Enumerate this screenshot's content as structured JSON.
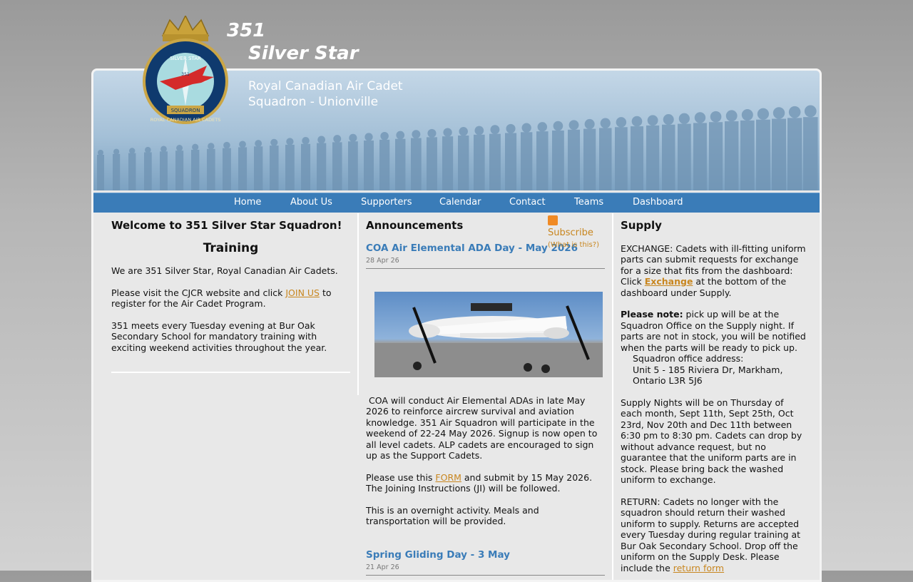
{
  "site": {
    "number": "351",
    "name": "Silver Star",
    "subtitle_line1": "Royal Canadian Air Cadet",
    "subtitle_line2": "Squadron - Unionville"
  },
  "crest": {
    "top_text": "SILVER STAR",
    "number": "351",
    "band_text": "SQUADRON",
    "ring_text": "ROYAL CANADIAN AIR CADETS"
  },
  "nav": [
    "Home",
    "About Us",
    "Supporters",
    "Calendar",
    "Contact",
    "Teams",
    "Dashboard"
  ],
  "left": {
    "heading": "Welcome to 351 Silver Star Squadron!",
    "subheading": "Training",
    "p1": "We are 351 Silver Star, Royal Canadian Air Cadets.",
    "p2_before": "Please visit the CJCR website and click ",
    "p2_link": "JOIN US",
    "p2_after": " to register for the Air Cadet Program.",
    "p3": "351 meets every Tuesday evening at Bur Oak Secondary School for mandatory training with exciting weekend activities throughout the year."
  },
  "middle": {
    "heading": "Announcements",
    "subscribe": "Subscribe",
    "whatis": "(What is this?)",
    "post1": {
      "title": "COA Air Elemental ADA Day - May 2026",
      "date": "28 Apr 26",
      "p1": "COA will conduct Air Elemental ADAs in late May 2026 to reinforce aircrew survival and aviation knowledge. 351 Air Squadron will participate in the weekend of 22-24 May 2026. Signup is now open to all level cadets. ALP cadets are encouraged to sign up as the Support Cadets.",
      "p2_before": "Please use this ",
      "p2_link": "FORM",
      "p2_after": " and submit by 15 May 2026. The Joining Instructions (JI) will be followed.",
      "p3": "This is an overnight activity. Meals and transportation will be provided."
    },
    "post2": {
      "title": "Spring Gliding Day - 3 May",
      "date": "21 Apr 26"
    }
  },
  "right": {
    "heading": "Supply",
    "p1_before": "EXCHANGE: Cadets with ill-fitting uniform parts can submit requests for exchange for a size that fits from the dashboard: Click ",
    "p1_link": "Exchange",
    "p1_after": " at the bottom of the dashboard under Supply.",
    "note_label": "Please note:",
    "note_text": " pick up will be at the Squadron Office on the Supply night. If parts are not in stock, you will be notified when the parts will be ready to pick up.",
    "addr1": "Squadron office address:",
    "addr2": "Unit 5 - 185 Riviera Dr,  Markham,",
    "addr3": "Ontario L3R 5J6",
    "p3": "Supply Nights will be on Thursday of each month, Sept 11th, Sept 25th, Oct 23rd, Nov 20th and Dec 11th between 6:30 pm to 8:30 pm. Cadets can drop by without advance request, but no guarantee that the uniform parts are in stock. Please bring back the washed uniform to exchange.",
    "p4_before": "RETURN: Cadets no longer with the squadron should return their washed uniform to supply. Returns are accepted every Tuesday during regular training at Bur Oak Secondary School. Drop off the uniform on the Supply Desk. Please include the ",
    "p4_link": "return form"
  },
  "colors": {
    "nav": "#3a7cb8",
    "link": "#c8861f",
    "post_title": "#3a7cb8"
  }
}
